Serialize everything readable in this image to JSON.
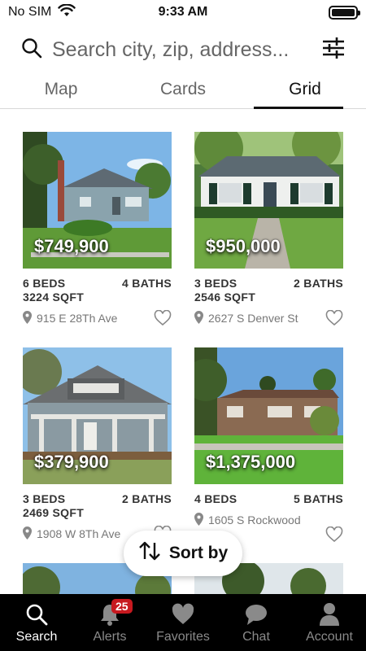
{
  "status_bar": {
    "carrier": "No SIM",
    "time": "9:33 AM"
  },
  "search": {
    "placeholder": "Search city, zip, address..."
  },
  "tabs": [
    {
      "label": "Map",
      "active": false
    },
    {
      "label": "Cards",
      "active": false
    },
    {
      "label": "Grid",
      "active": true
    }
  ],
  "listings": [
    {
      "price": "$749,900",
      "beds": "6 BEDS",
      "baths": "4 BATHS",
      "sqft": "3224 SQFT",
      "address": "915 E 28Th Ave"
    },
    {
      "price": "$950,000",
      "beds": "3 BEDS",
      "baths": "2 BATHS",
      "sqft": "2546 SQFT",
      "address": "2627 S Denver St"
    },
    {
      "price": "$379,900",
      "beds": "3 BEDS",
      "baths": "2 BATHS",
      "sqft": "2469 SQFT",
      "address": "1908 W 8Th Ave"
    },
    {
      "price": "$1,375,000",
      "beds": "4 BEDS",
      "baths": "5 BATHS",
      "sqft": "",
      "address": "1605 S Rockwood"
    }
  ],
  "sort": {
    "label": "Sort by"
  },
  "bottom_nav": [
    {
      "label": "Search",
      "icon": "search-icon",
      "active": true
    },
    {
      "label": "Alerts",
      "icon": "bell-icon",
      "badge": "25",
      "active": false
    },
    {
      "label": "Favorites",
      "icon": "heart-icon",
      "active": false
    },
    {
      "label": "Chat",
      "icon": "chat-bubble-icon",
      "active": false
    },
    {
      "label": "Account",
      "icon": "person-icon",
      "active": false
    }
  ],
  "colors": {
    "badge": "#c7191f",
    "nav_background": "#000000",
    "active_tab_underline": "#111111"
  }
}
